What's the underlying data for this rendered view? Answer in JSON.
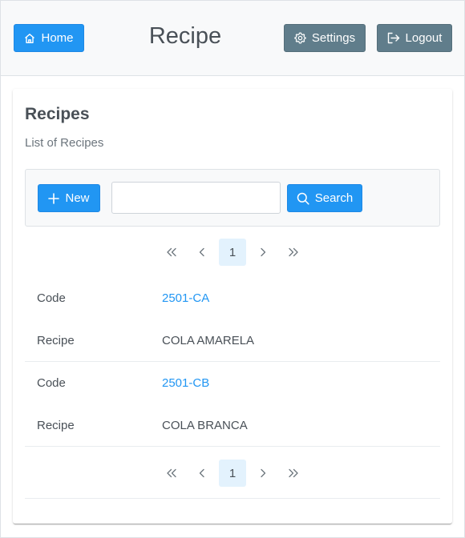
{
  "header": {
    "home_label": "Home",
    "title": "Recipe",
    "settings_label": "Settings",
    "logout_label": "Logout"
  },
  "card": {
    "title": "Recipes",
    "subtitle": "List of Recipes"
  },
  "toolbar": {
    "new_label": "New",
    "search_value": "",
    "search_label": "Search"
  },
  "pagination": {
    "current_page": "1"
  },
  "records": [
    {
      "code_label": "Code",
      "code": "2501-CA",
      "recipe_label": "Recipe",
      "recipe": "COLA AMARELA"
    },
    {
      "code_label": "Code",
      "code": "2501-CB",
      "recipe_label": "Recipe",
      "recipe": "COLA BRANCA"
    }
  ],
  "colors": {
    "primary": "#2196f3",
    "secondary": "#607d8b",
    "text": "#495057"
  },
  "icons": {
    "home": "home-icon",
    "settings": "gear-icon",
    "logout": "logout-icon",
    "new": "plus-icon",
    "search": "search-icon"
  }
}
